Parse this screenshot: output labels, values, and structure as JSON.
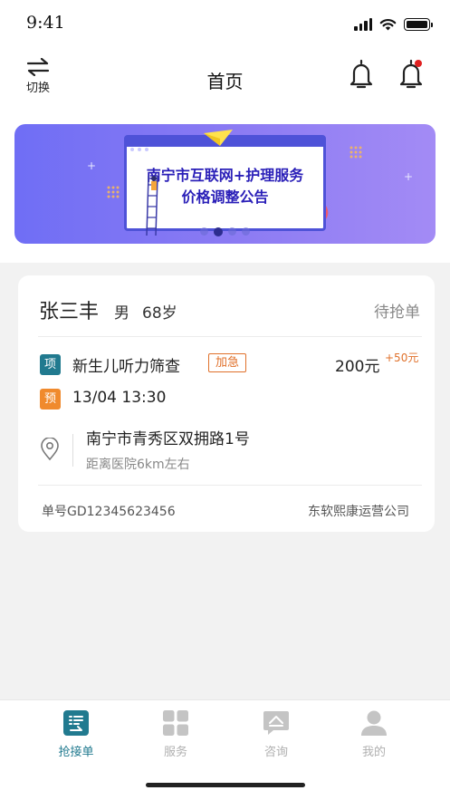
{
  "status_bar": {
    "time": "9:41"
  },
  "nav": {
    "switch_label": "切换",
    "title": "首页"
  },
  "banner": {
    "line1": "南宁市互联网+护理服务",
    "line2": "价格调整公告",
    "dots": 4,
    "active_dot": 2
  },
  "order": {
    "name": "张三丰",
    "gender": "男",
    "age": "68岁",
    "status": "待抢单",
    "service_tag": "项",
    "service": "新生儿听力筛查",
    "urgent": "加急",
    "price": "200元",
    "price_extra": "+50元",
    "appointment_tag": "预",
    "appointment": "13/04 13:30",
    "address": "南宁市青秀区双拥路1号",
    "distance": "距离医院6km左右",
    "order_no": "单号GD12345623456",
    "company": "东软熙康运营公司"
  },
  "tabs": [
    {
      "label": "抢接单",
      "icon": "order-grab-icon",
      "active": true
    },
    {
      "label": "服务",
      "icon": "grid-icon",
      "active": false
    },
    {
      "label": "咨询",
      "icon": "chat-icon",
      "active": false
    },
    {
      "label": "我的",
      "icon": "user-icon",
      "active": false
    }
  ],
  "colors": {
    "accent": "#217a8f",
    "urgent": "#e0702a",
    "alert": "#e02020",
    "banner_text": "#2a1fb8"
  }
}
